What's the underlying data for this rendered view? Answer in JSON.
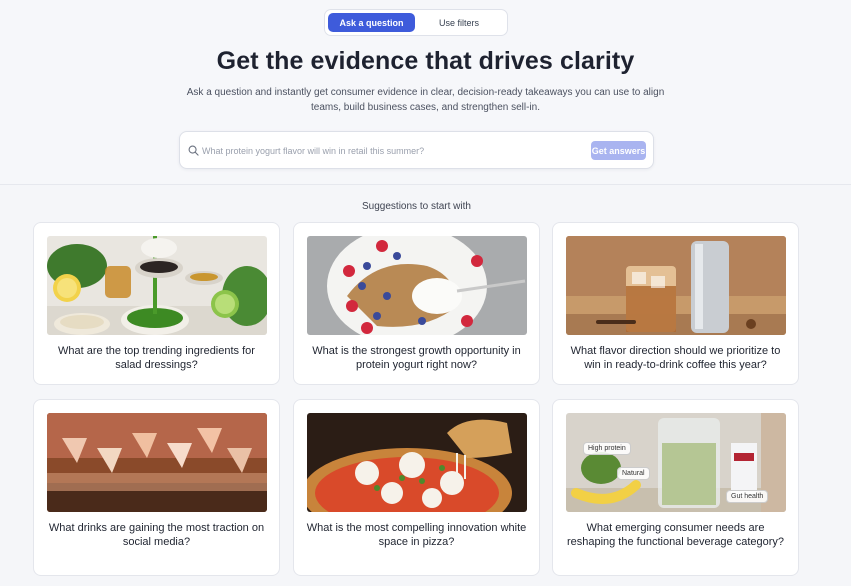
{
  "mode_tabs": {
    "active": "Ask a question",
    "inactive": "Use filters"
  },
  "hero": {
    "title": "Get the evidence that drives clarity",
    "subtitle": "Ask a question and instantly get consumer evidence in clear, decision-ready takeaways you can use to align teams, build business cases, and strengthen sell-in."
  },
  "search": {
    "placeholder": "What protein yogurt flavor will win in retail this summer?",
    "button_label": "Get answers",
    "icon": "search-icon"
  },
  "suggestions": {
    "heading": "Suggestions to start with",
    "cards": [
      {
        "question": "What are the top trending ingredients for salad dressings?",
        "image": "salad-dressing-photo"
      },
      {
        "question": "What is the strongest growth opportunity in protein yogurt right now?",
        "image": "yogurt-bowl-photo"
      },
      {
        "question": "What flavor direction should we prioritize to win in ready-to-drink coffee this year?",
        "image": "iced-coffee-photo"
      },
      {
        "question": "What drinks are gaining the most traction on social media?",
        "image": "cocktail-toast-photo"
      },
      {
        "question": "What is the most compelling innovation white space in pizza?",
        "image": "pizza-photo"
      },
      {
        "question": "What emerging consumer needs are reshaping the functional beverage category?",
        "image": "smoothie-photo",
        "tags": [
          "High protein",
          "Natural",
          "Gut health"
        ]
      }
    ]
  },
  "colors": {
    "accent": "#3e5bdb",
    "button_disabled": "#a9b4f0",
    "background": "#f5f6f9"
  }
}
